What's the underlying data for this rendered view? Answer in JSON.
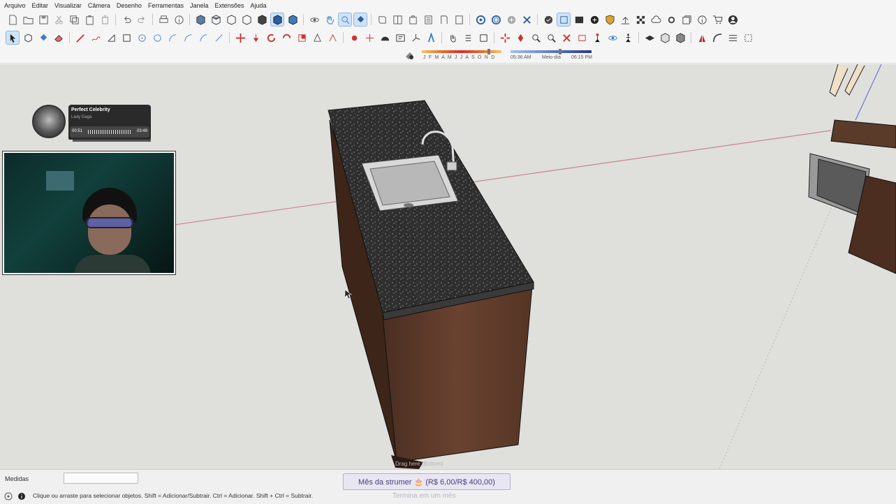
{
  "menu": [
    "Arquivo",
    "Editar",
    "Visualizar",
    "Câmera",
    "Desenho",
    "Ferramentas",
    "Janela",
    "Extensões",
    "Ajuda"
  ],
  "shadows": {
    "months": "J F M A M J J A S O N D",
    "time_start": "05:36 AM",
    "time_mid": "Meio-dia",
    "time_end": "06:15 PM"
  },
  "music": {
    "title": "Perfect Celebrity",
    "artist": "Lady Gaga",
    "elapsed": "00:51",
    "total": "03:49",
    "progress": 0.22
  },
  "status": {
    "measurements_label": "Medidas",
    "measurements_value": "",
    "hint": "Clique ou arraste para selecionar objetos. Shift = Adicionar/Subtrair. Ctrl = Adicionar. Shift + Ctrl = Subtrair."
  },
  "overlay": {
    "goal": "Mês da strumer 🎂 (R$ 6,00/R$ 400,00)",
    "goal_sub": "Termina em um mês",
    "faded_label": "Drag here (Bottom)"
  },
  "colors": {
    "accent": "#2a7ad5",
    "granite": "#2e2e2e",
    "wood": "#5a3a2a",
    "axis_red": "#c24a4a"
  }
}
